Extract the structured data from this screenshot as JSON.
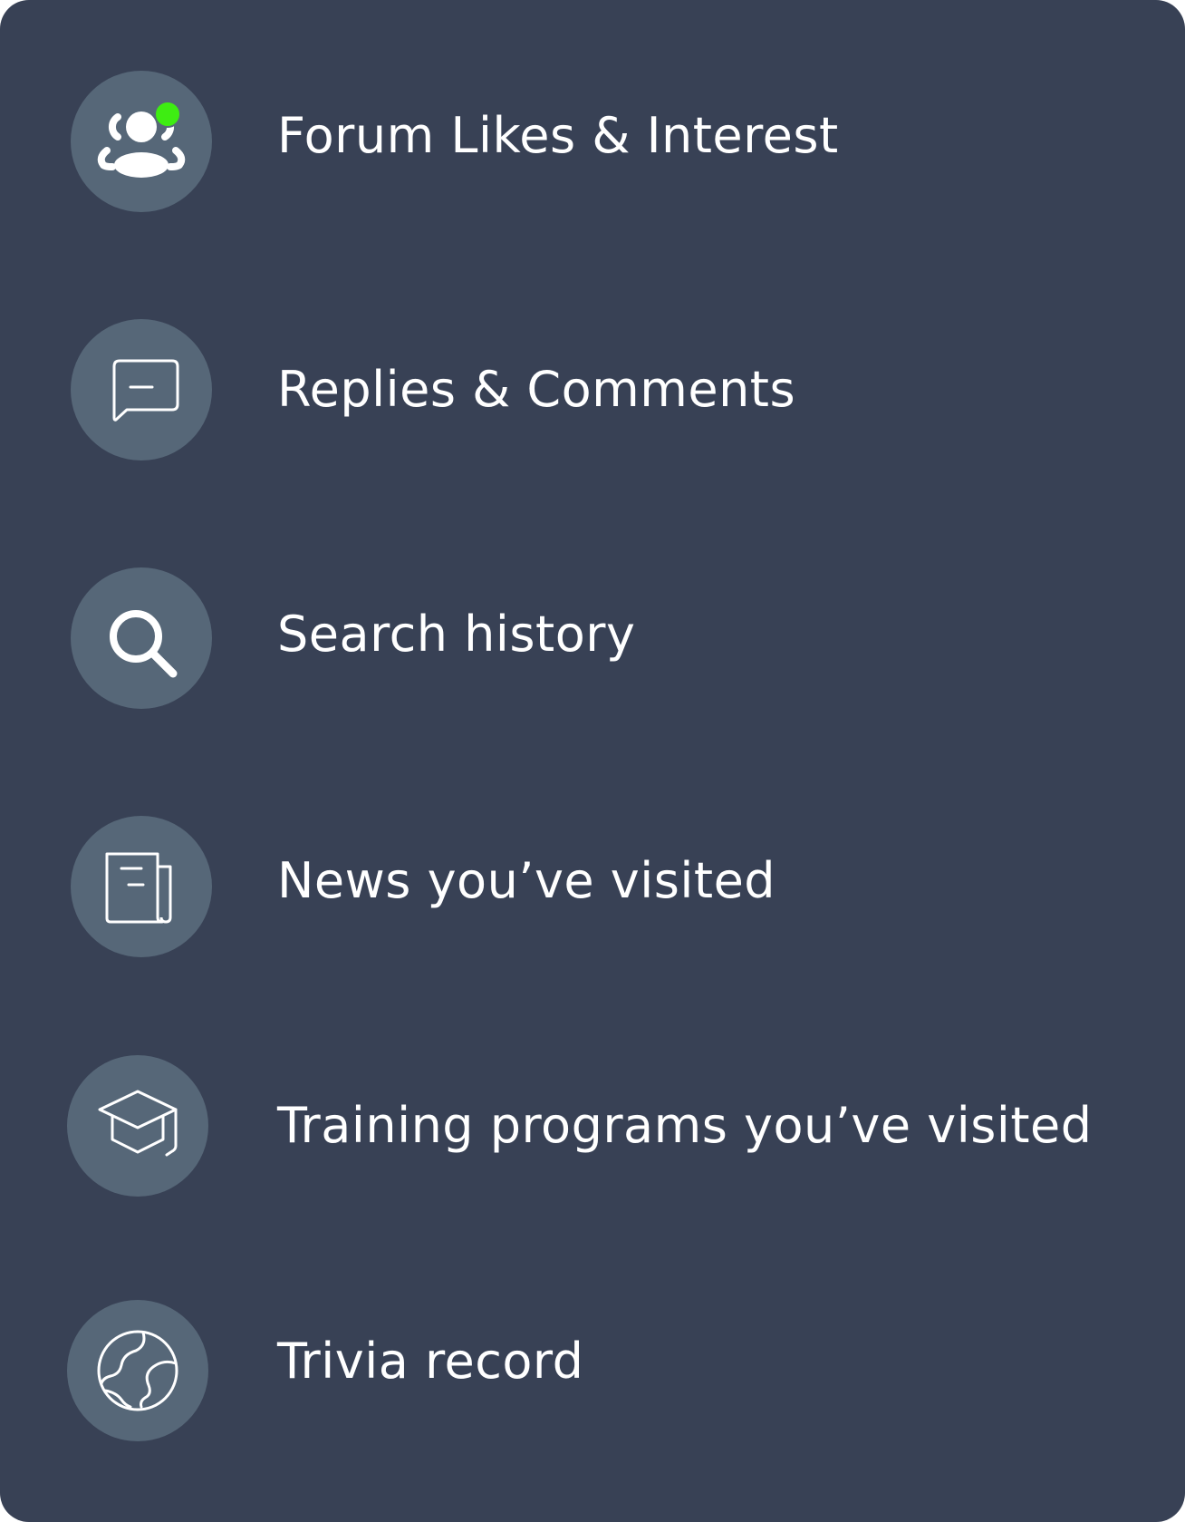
{
  "colors": {
    "panel_background": "#384155",
    "icon_circle": "#566778",
    "text": "#ffffff",
    "notification_dot": "#3eed12"
  },
  "menu": {
    "items": [
      {
        "label": "Forum Likes & Interest",
        "icon": "community-icon",
        "has_notification": true
      },
      {
        "label": "Replies & Comments",
        "icon": "comment-icon"
      },
      {
        "label": "Search history",
        "icon": "search-icon"
      },
      {
        "label": "News you’ve visited",
        "icon": "newspaper-icon"
      },
      {
        "label": "Training programs you’ve visited",
        "icon": "graduation-cap-icon"
      },
      {
        "label": "Trivia record",
        "icon": "globe-icon"
      }
    ]
  }
}
